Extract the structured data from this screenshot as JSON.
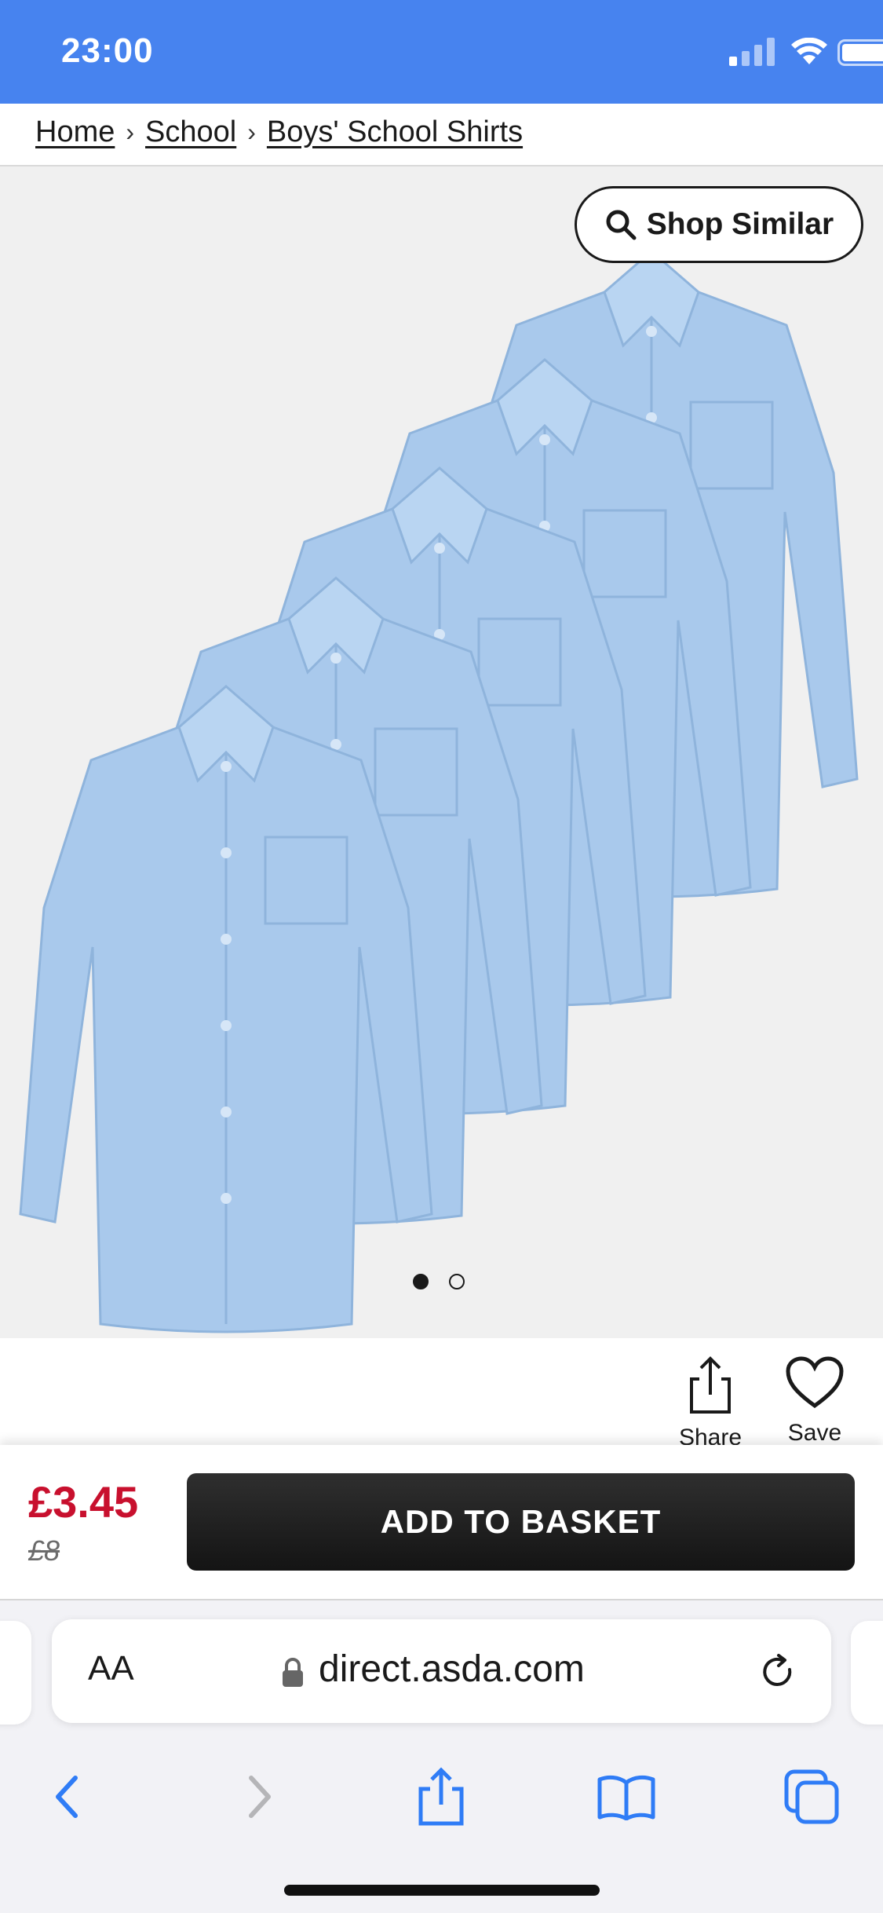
{
  "status_bar": {
    "time": "23:00"
  },
  "breadcrumb": {
    "home": "Home",
    "school": "School",
    "category": "Boys' School Shirts",
    "separator": "›"
  },
  "product": {
    "shop_similar": "Shop Similar",
    "image_alt": "Boys' blue long sleeve school shirts, 5 pack",
    "carousel": {
      "count": 2,
      "active": 0
    }
  },
  "actions": {
    "share": "Share",
    "save": "Save"
  },
  "pricing": {
    "current": "£3.45",
    "was": "£8",
    "add_to_basket": "ADD TO BASKET"
  },
  "browser": {
    "text_size": "AA",
    "url": "direct.asda.com"
  },
  "colors": {
    "status_bar": "#4783ef",
    "price": "#c8102e",
    "button": "#1f1f1f",
    "ios_blue": "#2f7cf6",
    "shirt": "#a9c9ec"
  },
  "icons": [
    "signal-icon",
    "wifi-icon",
    "battery-icon",
    "search-icon",
    "share-icon",
    "heart-icon",
    "lock-icon",
    "reload-icon",
    "back-icon",
    "forward-icon",
    "share-sheet-icon",
    "bookmarks-icon",
    "tabs-icon"
  ]
}
